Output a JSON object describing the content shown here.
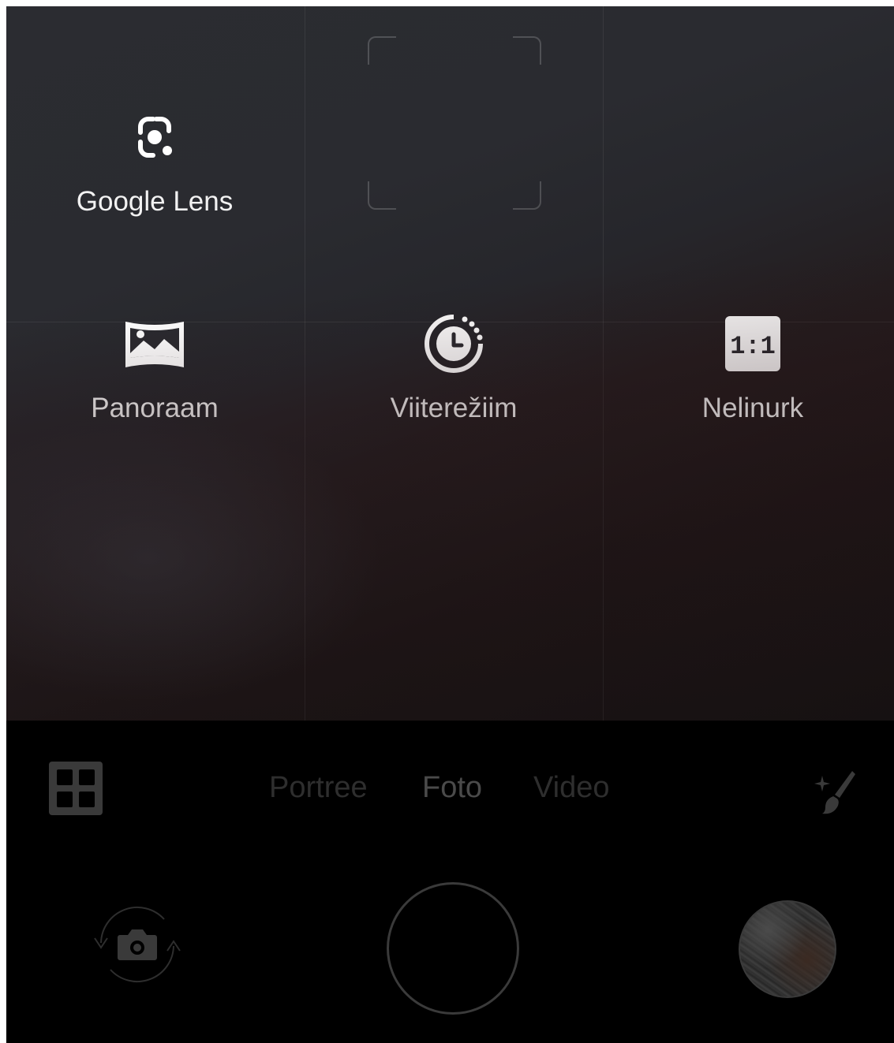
{
  "modes_panel": {
    "items": [
      {
        "label": "Google Lens",
        "icon": "google-lens-icon"
      },
      {
        "label": "Panoraam",
        "icon": "panorama-icon"
      },
      {
        "label": "Viiterežiim",
        "icon": "timelapse-icon"
      },
      {
        "label": "Nelinurk",
        "icon": "square-ratio-icon",
        "icon_text": "1:1"
      }
    ]
  },
  "mode_tabs": {
    "items": [
      "Portree",
      "Foto",
      "Video"
    ],
    "selected": "Foto"
  },
  "colors": {
    "label_text": "#f2f2f2",
    "tab_dim": "#2e2e2e",
    "tab_active": "#4a4a4a",
    "control_icon": "#3a3a3a"
  }
}
